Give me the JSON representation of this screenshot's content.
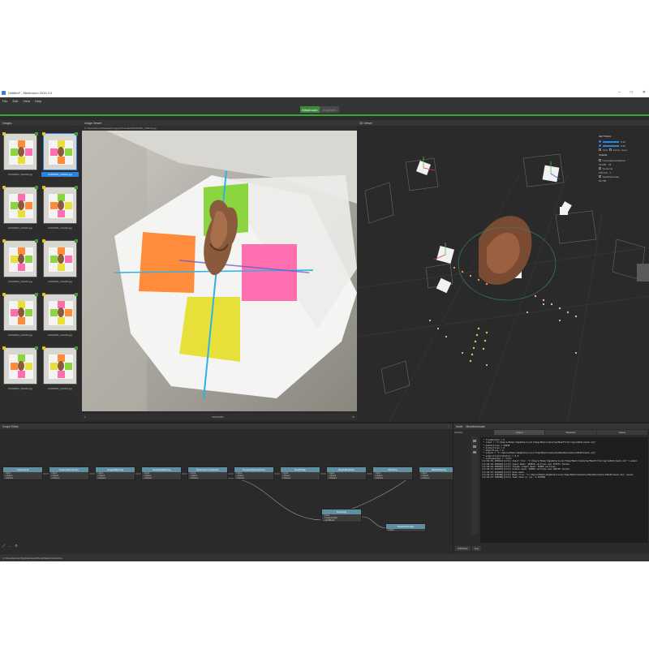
{
  "window": {
    "title": "Untitled* - Meshroom 2019.2.0",
    "controls": [
      "–",
      "□",
      "✕"
    ]
  },
  "menu": [
    "File",
    "Edit",
    "View",
    "Help"
  ],
  "modes": {
    "active": "Meshroom",
    "inactive": "Augment"
  },
  "images_panel": {
    "title": "Images",
    "thumbnails": [
      "20190305_144009.jpg",
      "20190305_144012.jpg",
      "20190305_144016.jpg",
      "20190305_144020.jpg",
      "20190305_144024.jpg",
      "20190305_144028.jpg",
      "20190305_144032.jpg",
      "20190305_144036.jpg",
      "20190305_144040.jpg",
      "20190305_144044.jpg"
    ],
    "selected_index": 1,
    "count": "48"
  },
  "viewer": {
    "title": "Image Viewer",
    "path": "C:/Users/Homer/Desktop/Images/chocolate/20190305_144012.jpg",
    "footer_left": "1",
    "footer_mid": "4000x3000",
    "footer_right": "⚙"
  },
  "scene": {
    "title": "3D Viewer",
    "settings": {
      "section_settings": "SETTINGS",
      "point_size": "0.10",
      "camera_scale": "0.30",
      "labels": [
        "Grid",
        "Gizmo",
        "Keys"
      ],
      "section_scene": "SCENE",
      "items": [
        {
          "name": "StructureFromMotion",
          "count": "15,655 · 78"
        },
        {
          "name": "Texturing",
          "count": "378,115 · 1"
        },
        {
          "name": "MeshDecimate",
          "count": "50,758"
        }
      ]
    }
  },
  "graph": {
    "title": "Graph Editor",
    "nodes": [
      "CameraInit",
      "FeatureExtraction",
      "ImageMatching",
      "FeatureMatching",
      "StructureFromMotion",
      "PrepareDenseScene",
      "DepthMap",
      "DepthMapFilter",
      "Meshing",
      "MeshFiltering"
    ],
    "extra_nodes": [
      "Texturing",
      "MeshDecimate"
    ]
  },
  "node_panel": {
    "title": "Node",
    "node_name": "MeshDecimate",
    "tabs": [
      "Output",
      "Statistics",
      "Status"
    ],
    "chunks_label": "Chunks",
    "log_lines": [
      " * flipNormals = 0",
      " * input = \"C:/Users/Homer/AppData/Local/Temp/MeshroomCache/MeshFiltering/1a2b3c/mesh.obj\"",
      " * maxVertices = 50000",
      " * minVertices = 0",
      " * nbVertices = 0",
      " * output = \"C:/Users/Homer/AppData/Local/Temp/MeshroomCache/MeshDecimate/4d5e6f/mesh.obj\"",
      " * simplificationFactor = 0.5",
      " * verboseLevel = \"info\"",
      "",
      "[11:04:35.385914][info] Input file: \"C:/Users/Homer/AppData/Local/Temp/MeshroomCache/MeshFiltering/1a2b3c/mesh.obj\" loaded.",
      "[11:04:35.385964][info] Input mesh: 189870 vertices and 379531 facets.",
      "[11:04:35.385984][info] Target output mesh: 50000 vertices.",
      "[11:04:37.461853][info] Output mesh: 50000 vertices and 100758 facets.",
      "[11:04:37.461903][info] Save mesh.",
      "[11:04:37.785568][info] Mesh file: \"C:/Users/Homer/AppData/Local/Temp/MeshroomCache/MeshDecimate/4d5e6f/mesh.obj\" saved.",
      "[11:04:37.785588][info] Task done in (s): 2.353999"
    ],
    "footer_tabs": [
      "Attributes",
      "Log"
    ]
  },
  "statusbar": "C:/Users/Homer/AppData/Local/Temp/MeshroomCache",
  "colors": {
    "accent_green": "#3aa63a",
    "selection_blue": "#2a82da",
    "node_header": "#5f8fa0"
  }
}
